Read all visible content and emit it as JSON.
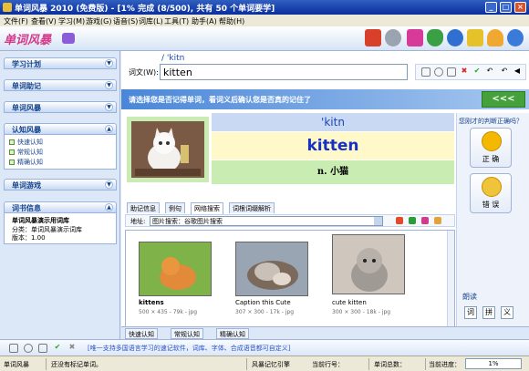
{
  "window": {
    "title": "单词风暴 2010 (免费版) - [1% 完成 (8/500), 共有 50 个单词要学]",
    "controls": [
      "minimize-icon",
      "maximize-icon",
      "close-icon"
    ]
  },
  "menu": [
    "文件(F)",
    "查看(V)",
    "学习(M)",
    "游戏(G)",
    "语音(S)",
    "词库(L)",
    "工具(T)",
    "助手(A)",
    "帮助(H)"
  ],
  "toolbar": {
    "logo": "单词风暴",
    "icons": [
      "home-icon",
      "disc-icon",
      "music-icon",
      "shield-icon",
      "user-icon",
      "document-icon",
      "lightbulb-icon",
      "help-icon"
    ]
  },
  "sidebar": {
    "study_plan": "学习计划",
    "word_memory": "单词助记",
    "word_storm": "单词风暴",
    "cognition": {
      "title": "认知风暴",
      "items": [
        "快速认知",
        "常规认知",
        "精确认知"
      ]
    },
    "games": "单词游戏",
    "book": {
      "title": "词书信息",
      "name": "单词风暴演示用词库",
      "category": "分类：单词风暴演示词库",
      "version": "版本：1.00"
    }
  },
  "word": {
    "phonetic_top": "/ 'kitn",
    "label": "词文(W):",
    "value": "kitten",
    "phonetic": "'kitn",
    "display": "kitten",
    "meaning": "n. 小猫"
  },
  "edit_toolbar": [
    "new-icon",
    "search-icon",
    "edit-icon",
    "delete-icon",
    "check-icon",
    "undo-icon",
    "undo2-icon",
    "speaker-icon"
  ],
  "hint": "请选择您是否记得单词，看词义后确认您是否真的记住了",
  "hint_go": "<<<",
  "judge": {
    "question": "您刚才的判断正确吗？",
    "correct": "正 确",
    "wrong": "错 误"
  },
  "read": {
    "label": "朗读",
    "buttons": [
      "词",
      "拼",
      "义"
    ]
  },
  "tabs": [
    "助记信息",
    "例句",
    "网络搜索",
    "词根词缀解析"
  ],
  "address": {
    "label": "地址:",
    "value": "图片搜索：谷歌图片搜索"
  },
  "results": [
    {
      "caption": "kittens",
      "dims": "500 × 435 - 79k - jpg"
    },
    {
      "caption": "Caption this Cute",
      "dims": "307 × 300 - 17k - jpg"
    },
    {
      "caption": "cute kitten",
      "dims": "300 × 300 - 18k - jpg"
    }
  ],
  "bottom_tabs": [
    "快速认知",
    "常规认知",
    "精确认知"
  ],
  "bottom_toolbar": {
    "icons": [
      "new-icon",
      "search-icon",
      "edit-icon",
      "check-icon",
      "delete-icon"
    ],
    "promo": "[唯一支持多国语言学习的速记软件，词库、字体、合成语音都可自定义]"
  },
  "status": {
    "app": "单词风暴",
    "msg": "还没有标记单词。",
    "engine": "风暴记忆引擎",
    "row": "当前行号：",
    "total": "单词总数：",
    "progress_label": "当前进度：",
    "progress": "1%"
  },
  "colors": {
    "title_bar": "#0a2e9e",
    "phonetic_band": "#cad9f3",
    "word_band": "#fff8c9",
    "meaning_band": "#c9ecb3",
    "word_text": "#1530c8"
  }
}
